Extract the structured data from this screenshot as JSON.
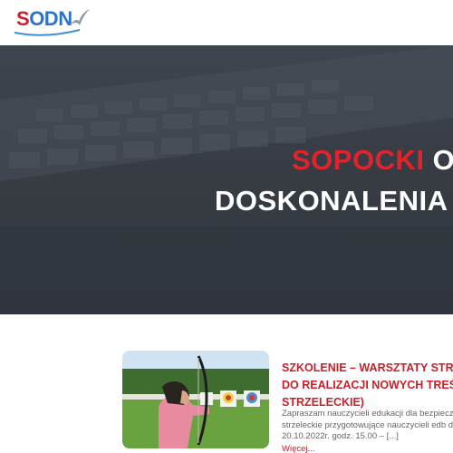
{
  "header": {
    "logo": {
      "text_s": "S",
      "text_rest": "ODN",
      "icon": "seagull-logo-icon"
    }
  },
  "hero": {
    "title_red": "SOPOCKI",
    "title_white": "O",
    "title_line2": "DOSKONALENIA"
  },
  "post": {
    "title_lines": [
      "SZKOLENIE – WARSZTATY STRZ",
      "DO REALIZACJI NOWYCH TREŚ",
      "STRZELECKIE)"
    ],
    "excerpt_lines": [
      "Zapraszam nauczycieli edukacji dla bezpieczeńs",
      "strzeleckie przygotowujące nauczycieli edb do r",
      "20.10.2022r. godz. 15.00 – [...]"
    ],
    "more_label": "Więcej..."
  },
  "colors": {
    "brand_red": "#d0202a",
    "brand_blue": "#2b74c9",
    "hero_overlay": "#3b4047"
  }
}
